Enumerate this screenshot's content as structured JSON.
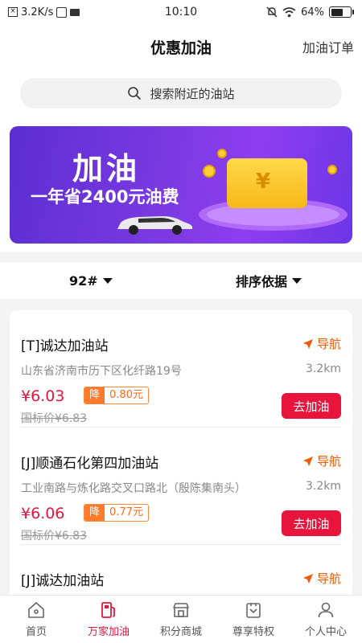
{
  "status_bar": {
    "speed": "3.2K/s",
    "time": "10:10",
    "battery": "64%",
    "battery_level": 0.64
  },
  "header": {
    "title": "优惠加油",
    "orders_label": "加油订单"
  },
  "search": {
    "placeholder": "搜索附近的油站"
  },
  "banner": {
    "title": "加油",
    "subtitle": "一年省2400元油费",
    "wallet_symbol": "¥"
  },
  "filters": {
    "fuel": "92#",
    "sort": "排序依据"
  },
  "stations": [
    {
      "name": "[T]诚达加油站",
      "nav_label": "导航",
      "address": "山东省济南市历下区化纤路19号",
      "distance": "3.2km",
      "price": "¥6.03",
      "discount_label": "降",
      "discount_value": "0.80元",
      "standard_price": "国标价¥6.83",
      "action_label": "去加油"
    },
    {
      "name": "[J]顺通石化第四加油站",
      "nav_label": "导航",
      "address": "工业南路与炼化路交叉口路北（殷陈集南头）",
      "distance": "3.2km",
      "price": "¥6.06",
      "discount_label": "降",
      "discount_value": "0.77元",
      "standard_price": "国标价¥6.83",
      "action_label": "去加油"
    },
    {
      "name": "[J]诚达加油站",
      "nav_label": "导航"
    }
  ],
  "tabs": [
    {
      "label": "首页",
      "icon": "home-icon"
    },
    {
      "label": "万家加油",
      "icon": "fuel-pump-icon"
    },
    {
      "label": "积分商城",
      "icon": "store-icon"
    },
    {
      "label": "尊享特权",
      "icon": "privilege-icon"
    },
    {
      "label": "个人中心",
      "icon": "user-icon"
    }
  ],
  "colors": {
    "accent": "#e8143c",
    "nav": "#f05a00",
    "discount": "#ff7a2a"
  }
}
